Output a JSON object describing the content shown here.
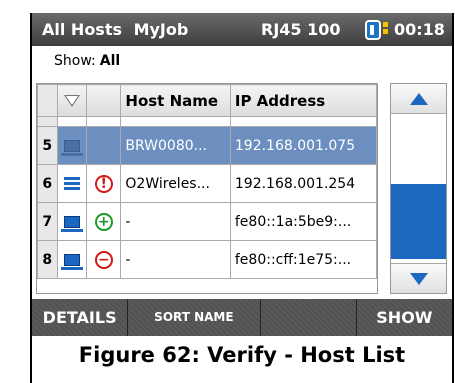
{
  "status_bar": {
    "title": "All Hosts",
    "job": "MyJob",
    "link": "RJ45 100",
    "time": "00:18"
  },
  "filter": {
    "label": "Show:",
    "value": "All"
  },
  "table": {
    "headers": {
      "host_name": "Host Name",
      "ip_address": "IP Address"
    },
    "rows": [
      {
        "num": "5",
        "type": "computer",
        "status": "",
        "host": "BRW0080...",
        "ip": "192.168.001.075",
        "selected": true
      },
      {
        "num": "6",
        "type": "server",
        "status": "warning",
        "host": "O2Wireles...",
        "ip": "192.168.001.254"
      },
      {
        "num": "7",
        "type": "computer",
        "status": "added",
        "host": "-",
        "ip": "fe80::1a:5be9:..."
      },
      {
        "num": "8",
        "type": "computer",
        "status": "removed",
        "host": "-",
        "ip": "fe80::cff:1e75:..."
      }
    ]
  },
  "icons": {
    "warning": "!",
    "added": "+",
    "removed": "−"
  },
  "softkeys": {
    "details": "DETAILS",
    "sort": "SORT NAME",
    "blank": "",
    "show": "SHOW"
  },
  "caption": "Figure 62: Verify - Host List"
}
